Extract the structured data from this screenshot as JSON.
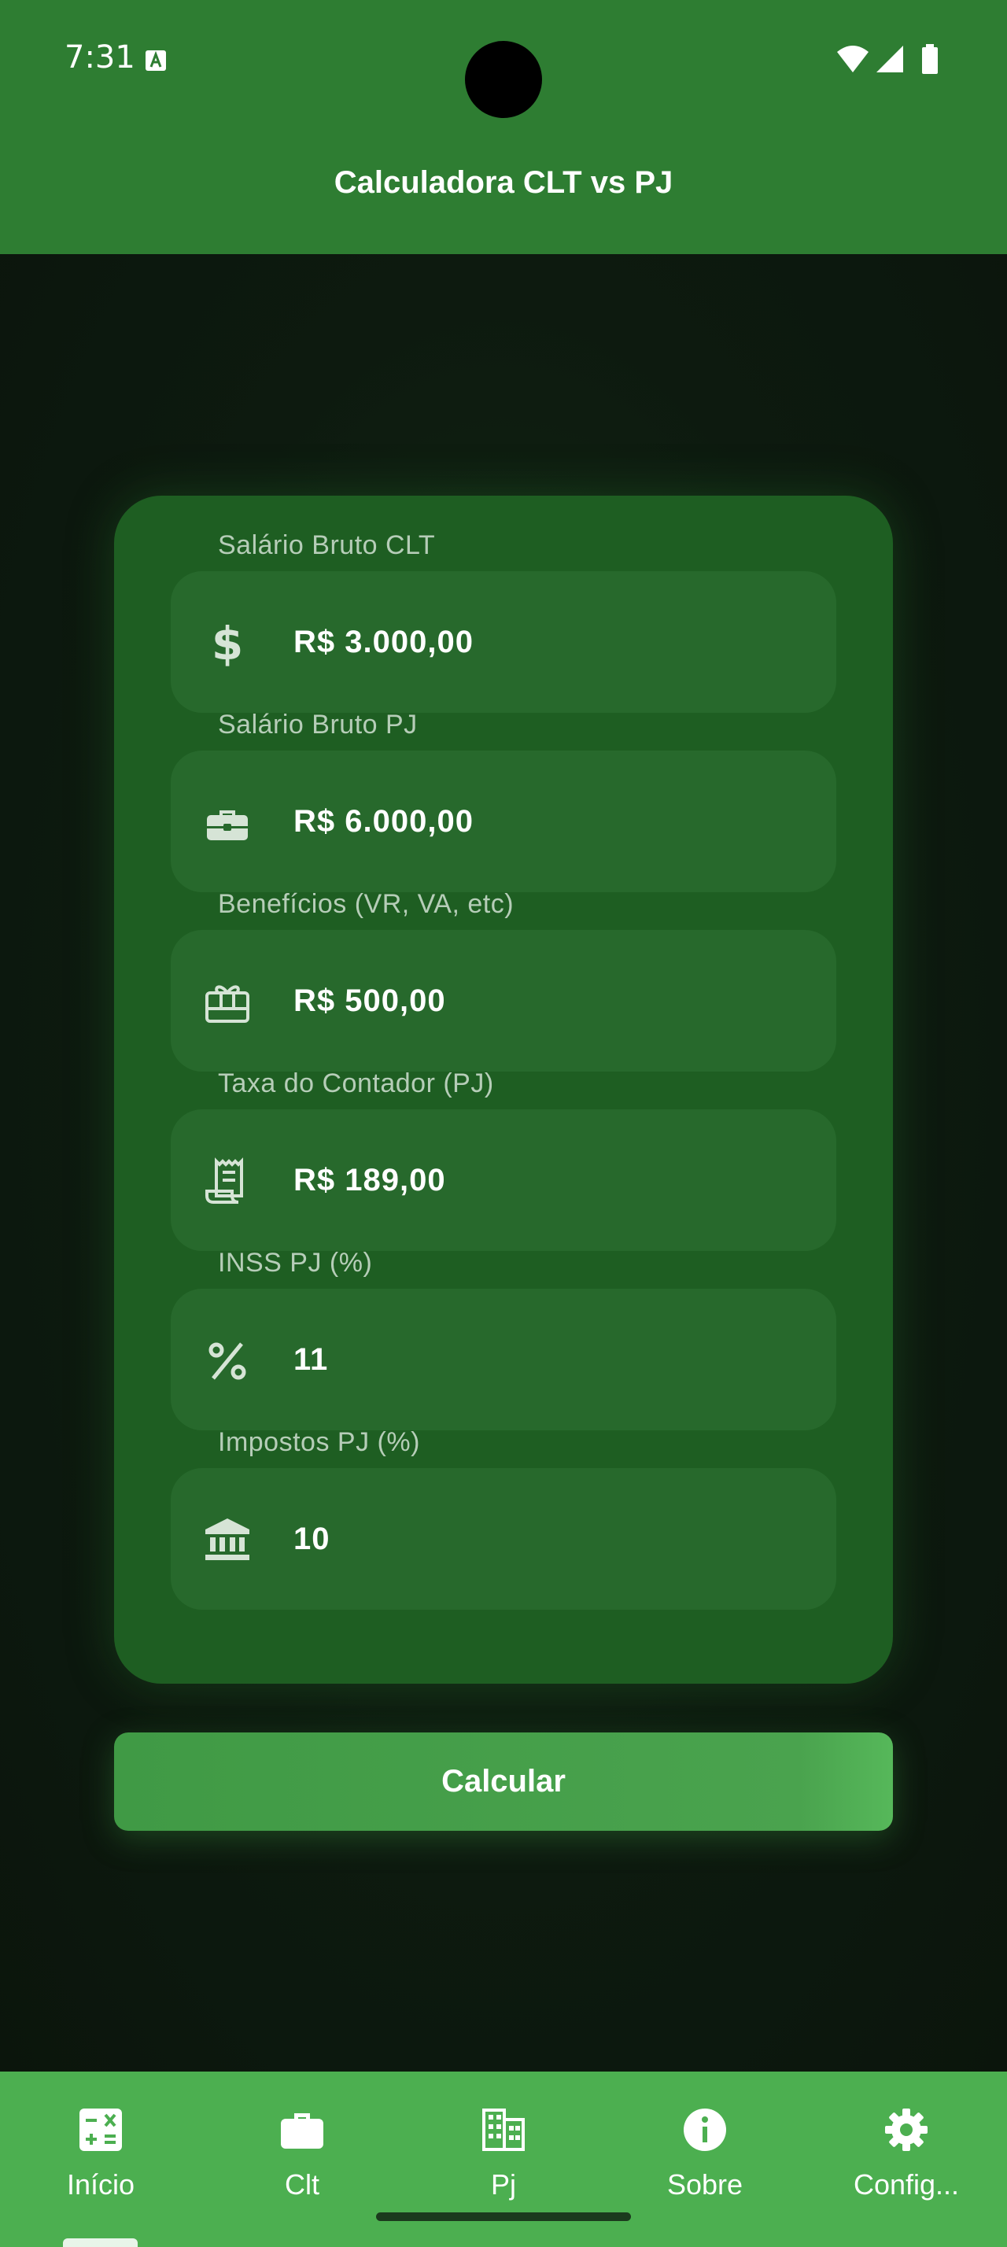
{
  "status_bar": {
    "time": "7:31"
  },
  "app_bar": {
    "title": "Calculadora CLT vs PJ"
  },
  "fields": [
    {
      "label": "Salário Bruto CLT",
      "value": "R$ 3.000,00",
      "icon": "dollar-icon"
    },
    {
      "label": "Salário Bruto PJ",
      "value": "R$ 6.000,00",
      "icon": "briefcase-icon"
    },
    {
      "label": "Benefícios (VR, VA, etc)",
      "value": "R$ 500,00",
      "icon": "gift-card-icon"
    },
    {
      "label": "Taxa do Contador (PJ)",
      "value": "R$ 189,00",
      "icon": "receipt-icon"
    },
    {
      "label": "INSS PJ (%)",
      "value": "11",
      "icon": "percent-icon"
    },
    {
      "label": "Impostos PJ (%)",
      "value": "10",
      "icon": "bank-icon"
    }
  ],
  "calculate_button": {
    "label": "Calcular"
  },
  "bottom_nav": [
    {
      "label": "Início",
      "icon": "calculator-icon",
      "active": true
    },
    {
      "label": "Clt",
      "icon": "briefcase-icon"
    },
    {
      "label": "Pj",
      "icon": "building-icon"
    },
    {
      "label": "Sobre",
      "icon": "info-icon"
    },
    {
      "label": "Config...",
      "icon": "gear-icon"
    }
  ],
  "colors": {
    "app_bar": "#2e7d32",
    "card": "#1e5e22",
    "field": "#27692c",
    "button": "#4aa34e",
    "bottom_nav": "#4caf50",
    "background": "#0e1a10"
  }
}
